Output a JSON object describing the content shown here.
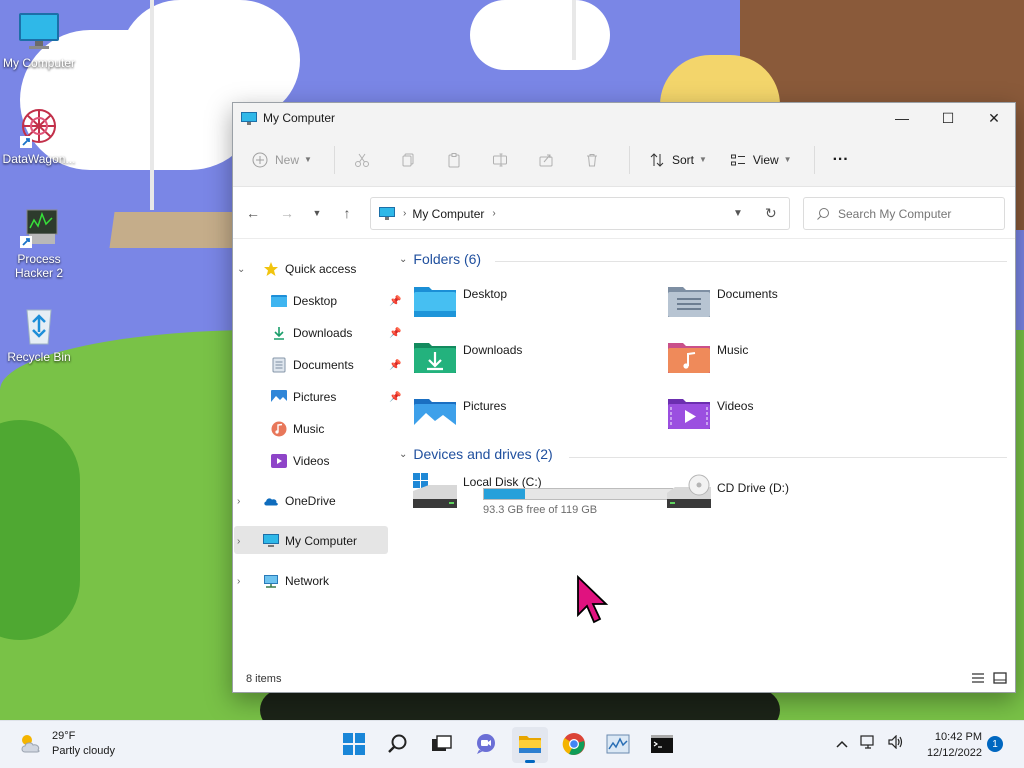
{
  "desktop": {
    "icons": [
      {
        "label": "My Computer"
      },
      {
        "label": "DataWagon..."
      },
      {
        "label": "Process Hacker 2"
      },
      {
        "label": "Recycle Bin"
      }
    ]
  },
  "window": {
    "title": "My Computer",
    "controls": {
      "minimize": "—",
      "maximize": "☐",
      "close": "✕"
    }
  },
  "commandbar": {
    "new_label": "New",
    "sort_label": "Sort",
    "view_label": "View",
    "more_label": "···"
  },
  "address": {
    "crumb": "My Computer",
    "search_placeholder": "Search My Computer"
  },
  "navpane": {
    "quick_access": "Quick access",
    "pinned": [
      {
        "label": "Desktop"
      },
      {
        "label": "Downloads"
      },
      {
        "label": "Documents"
      },
      {
        "label": "Pictures"
      }
    ],
    "music": "Music",
    "videos": "Videos",
    "onedrive": "OneDrive",
    "my_computer": "My Computer",
    "network": "Network"
  },
  "content": {
    "folders_header": "Folders (6)",
    "folders": [
      {
        "label": "Desktop"
      },
      {
        "label": "Documents"
      },
      {
        "label": "Downloads"
      },
      {
        "label": "Music"
      },
      {
        "label": "Pictures"
      },
      {
        "label": "Videos"
      }
    ],
    "drives_header": "Devices and drives (2)",
    "drives": [
      {
        "label": "Local Disk (C:)",
        "free_text": "93.3 GB free of 119 GB",
        "used_fraction": 0.216
      },
      {
        "label": "CD Drive (D:)"
      }
    ]
  },
  "statusbar": {
    "items_text": "8 items"
  },
  "taskbar": {
    "weather_temp": "29°F",
    "weather_desc": "Partly cloudy",
    "time": "10:42 PM",
    "date": "12/12/2022",
    "notification_count": "1"
  },
  "colors": {
    "accent": "#0067c0",
    "drive_bar": "#26a0da",
    "group_header": "#1f4f9e",
    "cursor": "#e0127f"
  }
}
